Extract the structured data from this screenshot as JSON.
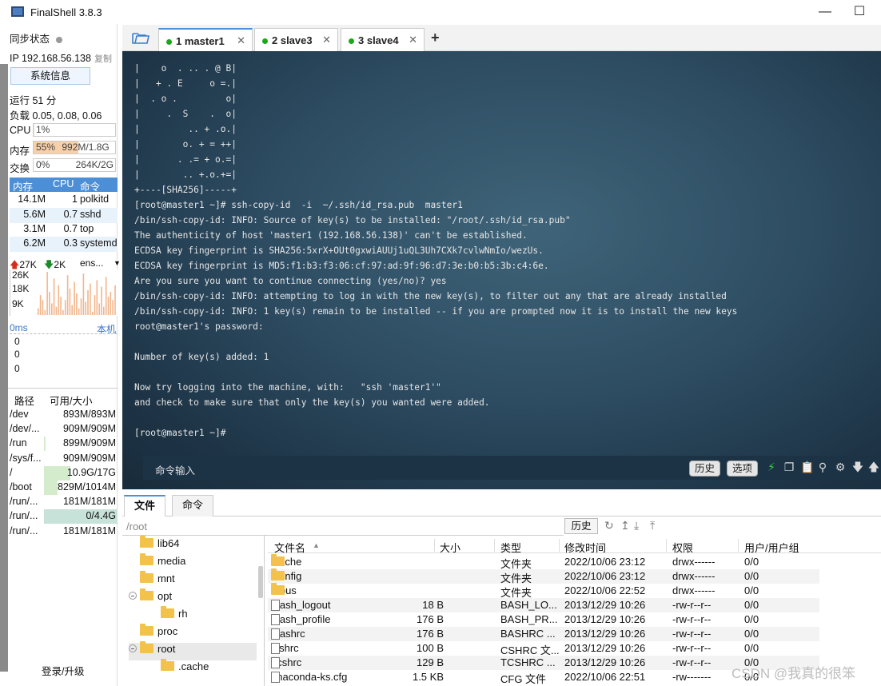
{
  "window": {
    "title": "FinalShell 3.8.3"
  },
  "status": {
    "sync_label": "同步状态",
    "ip": "IP 192.168.56.138",
    "copy_label": "复制",
    "sysinfo_button": "系统信息",
    "uptime": "运行 51 分",
    "load": "负载 0.05, 0.08, 0.06",
    "cpu_label": "CPU",
    "cpu_value": "1%",
    "cpu_fraction": 0.01,
    "mem_label": "内存",
    "mem_percent": "55%",
    "mem_value": "992M/1.8G",
    "mem_fraction": 0.55,
    "swap_label": "交换",
    "swap_percent": "0%",
    "swap_value": "264K/2G"
  },
  "processes": {
    "headers": [
      "内存",
      "CPU",
      "命令"
    ],
    "rows": [
      {
        "mem": "14.1M",
        "cpu": "1",
        "cmd": "polkitd"
      },
      {
        "mem": "5.6M",
        "cpu": "0.7",
        "cmd": "sshd"
      },
      {
        "mem": "3.1M",
        "cpu": "0.7",
        "cmd": "top"
      },
      {
        "mem": "6.2M",
        "cpu": "0.3",
        "cmd": "systemd"
      }
    ]
  },
  "network": {
    "up": "27K",
    "down": "2K",
    "iface": "ens...",
    "axis": [
      "26K",
      "18K",
      "9K"
    ],
    "samples": [
      4,
      12,
      9,
      3,
      26,
      14,
      7,
      22,
      5,
      18,
      11,
      3,
      9,
      24,
      16,
      6,
      20,
      13,
      4,
      10,
      25,
      8,
      15,
      19,
      2,
      12,
      21,
      7,
      17,
      5,
      23,
      11,
      14,
      9,
      18
    ]
  },
  "latency": {
    "ms": "0ms",
    "target": "本机",
    "values": [
      "0",
      "0",
      "0"
    ]
  },
  "disks": {
    "headers": [
      "路径",
      "可用/大小"
    ],
    "rows": [
      {
        "path": "/dev",
        "value": "893M/893M",
        "used": 0.0
      },
      {
        "path": "/dev/...",
        "value": "909M/909M",
        "used": 0.0
      },
      {
        "path": "/run",
        "value": "899M/909M",
        "used": 0.02
      },
      {
        "path": "/sys/f...",
        "value": "909M/909M",
        "used": 0.0
      },
      {
        "path": "/",
        "value": "10.9G/17G",
        "used": 0.36
      },
      {
        "path": "/boot",
        "value": "829M/1014M",
        "used": 0.18
      },
      {
        "path": "/run/...",
        "value": "181M/181M",
        "used": 0.0
      },
      {
        "path": "/run/...",
        "value": "0/4.4G",
        "used": 1.0
      },
      {
        "path": "/run/...",
        "value": "181M/181M",
        "used": 0.0
      }
    ]
  },
  "login_upgrade": "登录/升级",
  "tabs": [
    {
      "label": "1 master1",
      "active": true
    },
    {
      "label": "2 slave3",
      "active": false
    },
    {
      "label": "3 slave4",
      "active": false
    }
  ],
  "terminal": {
    "lines": [
      "|    o  . .. . @ B|",
      "|   + . E     o =.|",
      "|  . o .         o|",
      "|     .  S    .  o|",
      "|         .. + .o.|",
      "|        o. + = ++|",
      "|       . .= + o.=|",
      "|        .. +.o.+=|",
      "+----[SHA256]-----+",
      "[root@master1 ~]# ssh-copy-id  -i  ~/.ssh/id_rsa.pub  master1",
      "/bin/ssh-copy-id: INFO: Source of key(s) to be installed: \"/root/.ssh/id_rsa.pub\"",
      "The authenticity of host 'master1 (192.168.56.138)' can't be established.",
      "ECDSA key fingerprint is SHA256:5xrX+OUt0gxwiAUUj1uQL3Uh7CXk7cvlwNmIo/wezUs.",
      "ECDSA key fingerprint is MD5:f1:b3:f3:06:cf:97:ad:9f:96:d7:3e:b0:b5:3b:c4:6e.",
      "Are you sure you want to continue connecting (yes/no)? yes",
      "/bin/ssh-copy-id: INFO: attempting to log in with the new key(s), to filter out any that are already installed",
      "/bin/ssh-copy-id: INFO: 1 key(s) remain to be installed -- if you are prompted now it is to install the new keys",
      "root@master1's password:",
      "",
      "Number of key(s) added: 1",
      "",
      "Now try logging into the machine, with:   \"ssh 'master1'\"",
      "and check to make sure that only the key(s) you wanted were added.",
      "",
      "[root@master1 ~]#"
    ],
    "cmd_input_label": "命令输入",
    "history_button": "历史",
    "options_button": "选项"
  },
  "bottom": {
    "tabs": [
      "文件",
      "命令"
    ],
    "path": "/root",
    "history_button": "历史",
    "tree": [
      {
        "name": "lib64",
        "indent": 0,
        "toggle": false,
        "selected": false
      },
      {
        "name": "media",
        "indent": 0,
        "toggle": false,
        "selected": false
      },
      {
        "name": "mnt",
        "indent": 0,
        "toggle": false,
        "selected": false
      },
      {
        "name": "opt",
        "indent": 0,
        "toggle": true,
        "selected": false
      },
      {
        "name": "rh",
        "indent": 1,
        "toggle": false,
        "selected": false
      },
      {
        "name": "proc",
        "indent": 0,
        "toggle": false,
        "selected": false
      },
      {
        "name": "root",
        "indent": 0,
        "toggle": true,
        "selected": true
      },
      {
        "name": ".cache",
        "indent": 1,
        "toggle": false,
        "selected": false
      }
    ],
    "columns": [
      "文件名",
      "大小",
      "类型",
      "修改时间",
      "权限",
      "用户/用户组"
    ],
    "files": [
      {
        "name": ".cache",
        "size": "",
        "type": "文件夹",
        "mtime": "2022/10/06 23:12",
        "perm": "drwx------",
        "owner": "0/0",
        "folder": true
      },
      {
        "name": ".config",
        "size": "",
        "type": "文件夹",
        "mtime": "2022/10/06 23:12",
        "perm": "drwx------",
        "owner": "0/0",
        "folder": true
      },
      {
        "name": ".dbus",
        "size": "",
        "type": "文件夹",
        "mtime": "2022/10/06 22:52",
        "perm": "drwx------",
        "owner": "0/0",
        "folder": true
      },
      {
        "name": ".bash_logout",
        "size": "18 B",
        "type": "BASH_LO...",
        "mtime": "2013/12/29 10:26",
        "perm": "-rw-r--r--",
        "owner": "0/0",
        "folder": false
      },
      {
        "name": ".bash_profile",
        "size": "176 B",
        "type": "BASH_PR...",
        "mtime": "2013/12/29 10:26",
        "perm": "-rw-r--r--",
        "owner": "0/0",
        "folder": false
      },
      {
        "name": ".bashrc",
        "size": "176 B",
        "type": "BASHRC ...",
        "mtime": "2013/12/29 10:26",
        "perm": "-rw-r--r--",
        "owner": "0/0",
        "folder": false
      },
      {
        "name": ".cshrc",
        "size": "100 B",
        "type": "CSHRC 文...",
        "mtime": "2013/12/29 10:26",
        "perm": "-rw-r--r--",
        "owner": "0/0",
        "folder": false
      },
      {
        "name": ".tcshrc",
        "size": "129 B",
        "type": "TCSHRC ...",
        "mtime": "2013/12/29 10:26",
        "perm": "-rw-r--r--",
        "owner": "0/0",
        "folder": false
      },
      {
        "name": "anaconda-ks.cfg",
        "size": "1.5 KB",
        "type": "CFG 文件",
        "mtime": "2022/10/06 22:51",
        "perm": "-rw-------",
        "owner": "0/0",
        "folder": false
      }
    ]
  },
  "watermark": "CSDN @我真的很笨"
}
